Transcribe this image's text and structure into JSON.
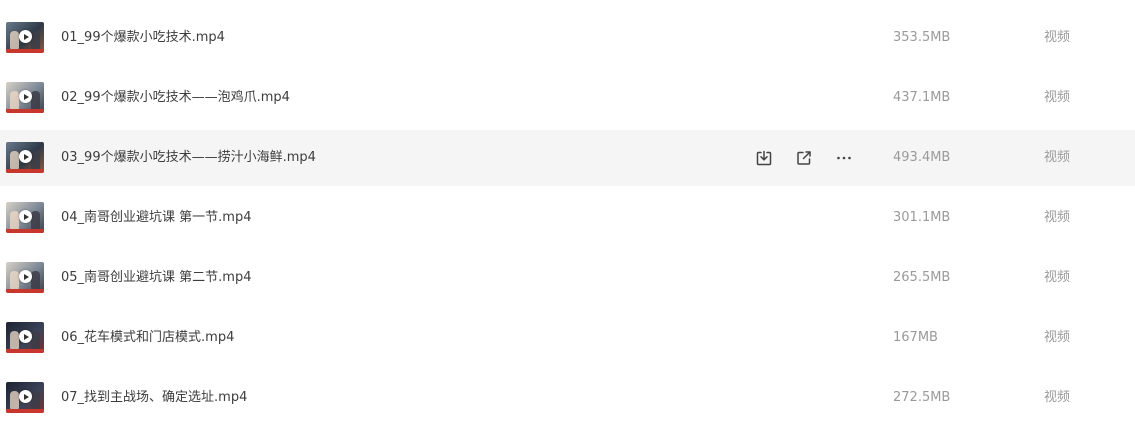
{
  "files": [
    {
      "name": "01_99个爆款小吃技术.mp4",
      "size": "353.5MB",
      "type": "视频",
      "thumbnail_icon": "video-thumbnail"
    },
    {
      "name": "02_99个爆款小吃技术——泡鸡爪.mp4",
      "size": "437.1MB",
      "type": "视频",
      "thumbnail_icon": "video-thumbnail"
    },
    {
      "name": "03_99个爆款小吃技术——捞汁小海鲜.mp4",
      "size": "493.4MB",
      "type": "视频",
      "thumbnail_icon": "video-thumbnail",
      "hovered": true
    },
    {
      "name": "04_南哥创业避坑课  第一节.mp4",
      "size": "301.1MB",
      "type": "视频",
      "thumbnail_icon": "video-thumbnail"
    },
    {
      "name": "05_南哥创业避坑课  第二节.mp4",
      "size": "265.5MB",
      "type": "视频",
      "thumbnail_icon": "video-thumbnail"
    },
    {
      "name": "06_花车模式和门店模式.mp4",
      "size": "167MB",
      "type": "视频",
      "thumbnail_icon": "video-thumbnail"
    },
    {
      "name": "07_找到主战场、确定选址.mp4",
      "size": "272.5MB",
      "type": "视频",
      "thumbnail_icon": "video-thumbnail"
    }
  ],
  "row_actions": [
    {
      "icon": "download-icon"
    },
    {
      "icon": "share-icon"
    },
    {
      "icon": "more-icon"
    }
  ],
  "colors": {
    "hover_background": "#f5f5f6",
    "name_text": "#3d3d3d",
    "meta_text": "#9a9a9a",
    "thumbnail_accent": "#c8372d"
  }
}
